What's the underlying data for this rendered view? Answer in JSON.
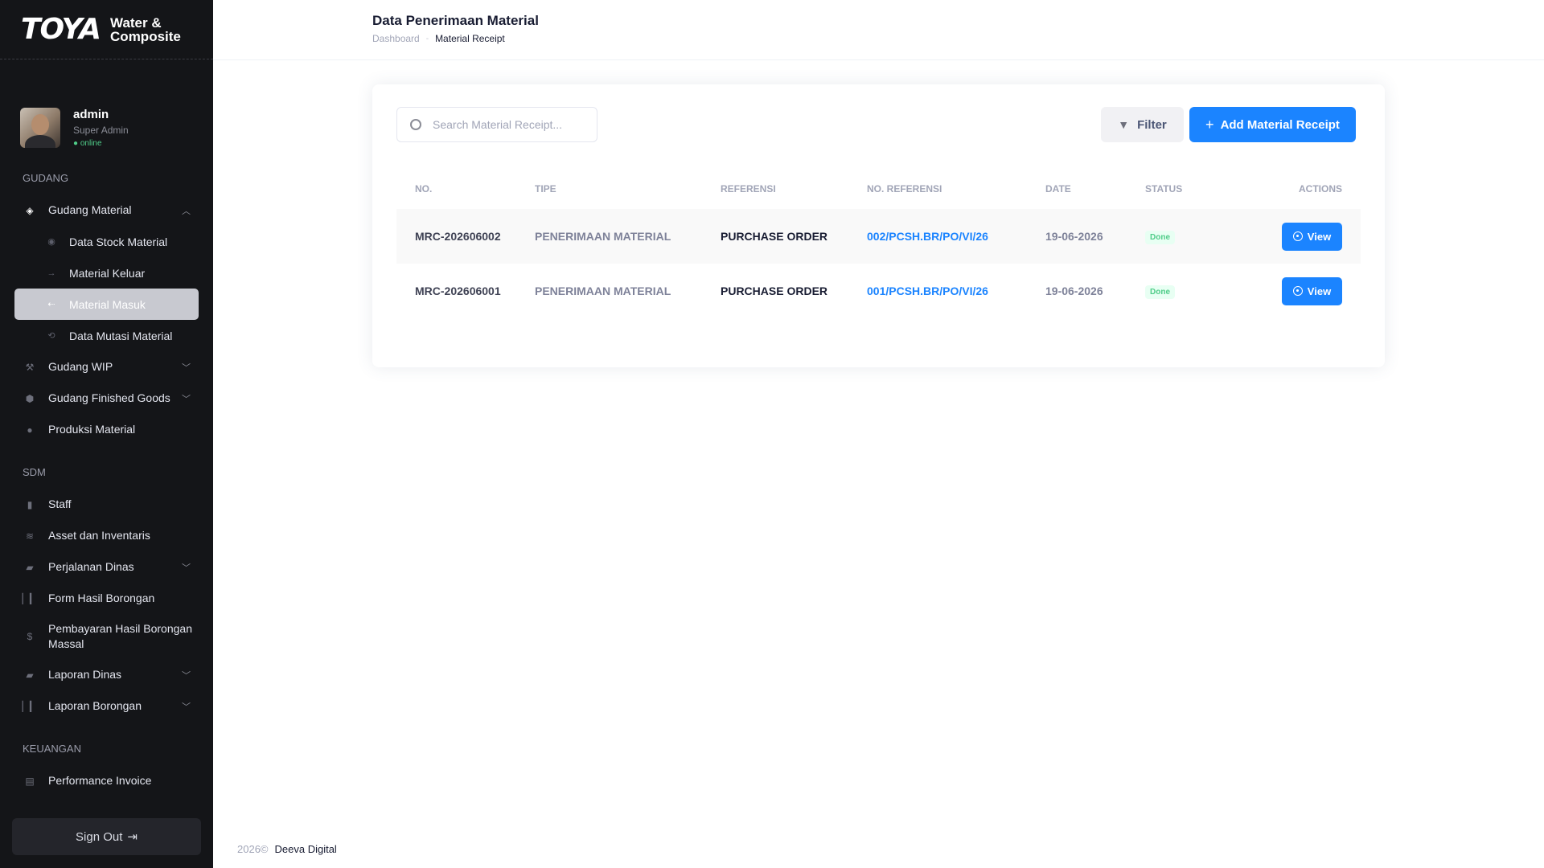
{
  "brand": {
    "logo": "TOYA",
    "subtitle_line1": "Water &",
    "subtitle_line2": "Composite"
  },
  "user": {
    "name": "admin",
    "role": "Super Admin",
    "status": "● online"
  },
  "sidebar": {
    "sections": [
      {
        "title": "GUDANG"
      },
      {
        "title": "SDM"
      },
      {
        "title": "KEUANGAN"
      }
    ],
    "gudang_material": {
      "label": "Gudang Material",
      "icon": "cube-icon"
    },
    "gudang_material_sub": [
      {
        "label": "Data Stock Material",
        "icon": "disc-icon"
      },
      {
        "label": "Material Keluar",
        "icon": "arrow-right-icon"
      },
      {
        "label": "Material Masuk",
        "icon": "arrow-in-icon"
      },
      {
        "label": "Data Mutasi Material",
        "icon": "refresh-icon"
      }
    ],
    "gudang_items": [
      {
        "label": "Gudang WIP",
        "icon": "wrench-icon"
      },
      {
        "label": "Gudang Finished Goods",
        "icon": "box-icon"
      },
      {
        "label": "Produksi Material",
        "icon": "circle-icon"
      }
    ],
    "sdm_items": [
      {
        "label": "Staff",
        "icon": "user-icon"
      },
      {
        "label": "Asset dan Inventaris",
        "icon": "layers-icon"
      },
      {
        "label": "Perjalanan Dinas",
        "icon": "briefcase-icon"
      },
      {
        "label": "Form Hasil Borongan",
        "icon": "chart-icon"
      },
      {
        "label": "Pembayaran Hasil Borongan Massal",
        "icon": "dollar-icon"
      },
      {
        "label": "Laporan Dinas",
        "icon": "briefcase-icon"
      },
      {
        "label": "Laporan Borongan",
        "icon": "chart-icon"
      }
    ],
    "keuangan_items": [
      {
        "label": "Performance Invoice",
        "icon": "invoice-icon"
      }
    ],
    "sign_out": "Sign Out"
  },
  "header": {
    "title": "Data Penerimaan Material",
    "breadcrumb": [
      "Dashboard",
      "Material Receipt"
    ]
  },
  "toolbar": {
    "search_placeholder": "Search Material Receipt...",
    "filter_label": "Filter",
    "add_label": "Add Material Receipt"
  },
  "table": {
    "columns": [
      "NO.",
      "TIPE",
      "REFERENSI",
      "NO. REFERENSI",
      "DATE",
      "STATUS",
      "ACTIONS"
    ],
    "rows": [
      {
        "no": "MRC-202606002",
        "tipe": "PENERIMAAN MATERIAL",
        "referensi": "PURCHASE ORDER",
        "no_referensi": "002/PCSH.BR/PO/VI/26",
        "date": "19-06-2026",
        "status": "Done",
        "action": "View"
      },
      {
        "no": "MRC-202606001",
        "tipe": "PENERIMAAN MATERIAL",
        "referensi": "PURCHASE ORDER",
        "no_referensi": "001/PCSH.BR/PO/VI/26",
        "date": "19-06-2026",
        "status": "Done",
        "action": "View"
      }
    ]
  },
  "footer": {
    "year": "2026©",
    "company": "Deeva Digital"
  },
  "colors": {
    "sidebar_bg": "#141518",
    "primary": "#1b84ff",
    "success": "#50cd89",
    "active_item": "#c8c9d0"
  }
}
